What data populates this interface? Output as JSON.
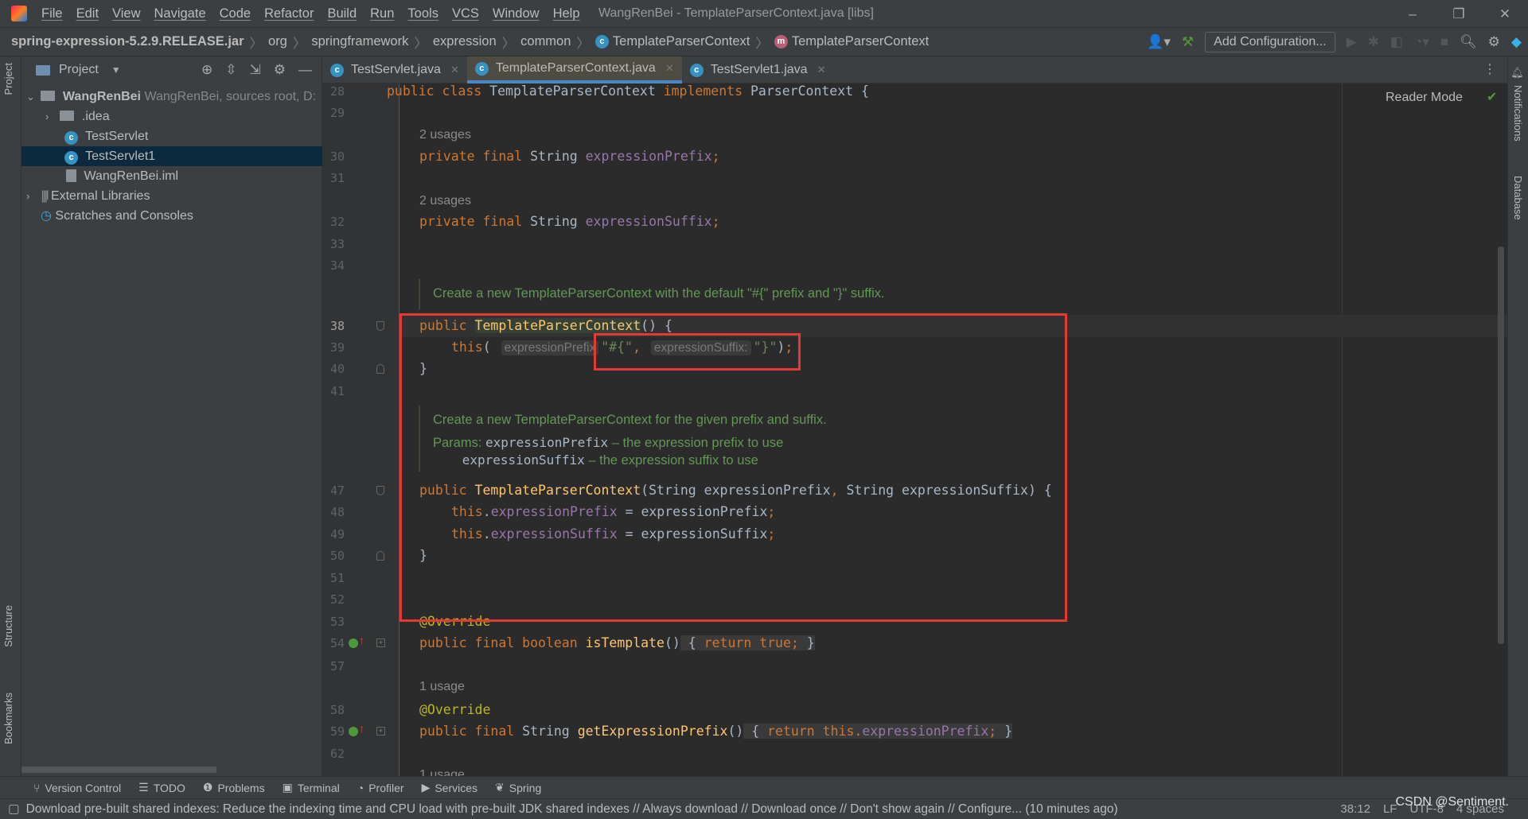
{
  "window": {
    "title": "WangRenBei - TemplateParserContext.java [libs]",
    "menu": [
      "File",
      "Edit",
      "View",
      "Navigate",
      "Code",
      "Refactor",
      "Build",
      "Run",
      "Tools",
      "VCS",
      "Window",
      "Help"
    ],
    "controls": {
      "minimize": "–",
      "restore": "❐",
      "close": "✕"
    }
  },
  "breadcrumb": {
    "jar": "spring-expression-5.2.9.RELEASE.jar",
    "packages": [
      "org",
      "springframework",
      "expression",
      "common"
    ],
    "class": "TemplateParserContext",
    "method": "TemplateParserContext"
  },
  "toolbar": {
    "add_configuration": "Add Configuration..."
  },
  "left_stripe": {
    "project": "Project",
    "structure": "Structure",
    "bookmarks": "Bookmarks"
  },
  "right_stripe": {
    "notifications": "Notifications",
    "database": "Database"
  },
  "project": {
    "title": "Project",
    "tree": [
      {
        "label": "WangRenBei",
        "hint": "WangRenBei,  sources root,  D:",
        "icon": "module-folder-icon",
        "expanded": true
      },
      {
        "label": ".idea",
        "icon": "folder-icon",
        "expanded": false
      },
      {
        "label": "TestServlet",
        "icon": "class-icon"
      },
      {
        "label": "TestServlet1",
        "icon": "class-icon",
        "selected": true
      },
      {
        "label": "WangRenBei.iml",
        "icon": "iml-file-icon"
      },
      {
        "label": "External Libraries",
        "icon": "libraries-icon",
        "expanded": false
      },
      {
        "label": "Scratches and Consoles",
        "icon": "scratches-icon"
      }
    ]
  },
  "tabs": [
    {
      "label": "TestServlet.java",
      "active": false
    },
    {
      "label": "TemplateParserContext.java",
      "active": true
    },
    {
      "label": "TestServlet1.java",
      "active": false
    }
  ],
  "editor": {
    "reader_mode": "Reader Mode",
    "current_line": "38",
    "rows": [
      {
        "kind": "code",
        "num": "28",
        "indent": 0,
        "tokens": [
          [
            "public class ",
            "k"
          ],
          [
            "TemplateParserContext ",
            "p"
          ],
          [
            "implements ",
            "k"
          ],
          [
            "ParserContext {",
            "p"
          ]
        ]
      },
      {
        "kind": "code",
        "num": "29",
        "indent": 0,
        "tokens": []
      },
      {
        "kind": "usage",
        "text": "2 usages"
      },
      {
        "kind": "code",
        "num": "30",
        "indent": 1,
        "tokens": [
          [
            "private final ",
            "k"
          ],
          [
            "String ",
            "p"
          ],
          [
            "expressionPrefix",
            "f"
          ],
          [
            ";",
            "k"
          ]
        ]
      },
      {
        "kind": "code",
        "num": "31",
        "indent": 0,
        "tokens": []
      },
      {
        "kind": "usage",
        "text": "2 usages"
      },
      {
        "kind": "code",
        "num": "32",
        "indent": 1,
        "tokens": [
          [
            "private final ",
            "k"
          ],
          [
            "String ",
            "p"
          ],
          [
            "expressionSuffix",
            "f"
          ],
          [
            ";",
            "k"
          ]
        ]
      },
      {
        "kind": "code",
        "num": "33",
        "indent": 0,
        "tokens": []
      },
      {
        "kind": "code",
        "num": "34",
        "indent": 0,
        "tokens": []
      },
      {
        "kind": "doc",
        "parts": [
          [
            "Create a new TemplateParserContext with the default \"#{\" prefix and \"}\" suffix.",
            "t"
          ]
        ]
      },
      {
        "kind": "code",
        "num": "38",
        "indent": 1,
        "fold": "open",
        "tokens": [
          [
            "public ",
            "k"
          ],
          [
            "TemplateParserContext",
            "mh"
          ],
          [
            "() {",
            "p"
          ]
        ]
      },
      {
        "kind": "code",
        "num": "39",
        "indent": 2,
        "tokens": [
          [
            "this",
            "k"
          ],
          [
            "( ",
            "p"
          ],
          [
            "expressionPrefix",
            "h"
          ],
          [
            "\"#{\"",
            "s"
          ],
          [
            ", ",
            "k"
          ],
          [
            "expressionSuffix:",
            "h"
          ],
          [
            "\"}\"",
            "s"
          ],
          [
            ")",
            "p"
          ],
          [
            ";",
            "k"
          ]
        ]
      },
      {
        "kind": "code",
        "num": "40",
        "indent": 1,
        "fold": "close",
        "tokens": [
          [
            "}",
            "p"
          ]
        ]
      },
      {
        "kind": "code",
        "num": "41",
        "indent": 0,
        "tokens": []
      },
      {
        "kind": "doc",
        "parts": [
          [
            "Create a new TemplateParserContext for the given prefix and suffix.",
            "t"
          ]
        ]
      },
      {
        "kind": "doc",
        "parts": [
          [
            "Params: ",
            "t"
          ],
          [
            "expressionPrefix",
            "mono"
          ],
          [
            " – the expression prefix to use",
            "t"
          ]
        ]
      },
      {
        "kind": "doc",
        "parts": [
          [
            "        ",
            "t"
          ],
          [
            "expressionSuffix",
            "mono"
          ],
          [
            " – the expression suffix to use",
            "t"
          ]
        ]
      },
      {
        "kind": "code",
        "num": "47",
        "indent": 1,
        "fold": "open",
        "tokens": [
          [
            "public ",
            "k"
          ],
          [
            "TemplateParserContext",
            "m"
          ],
          [
            "(String expressionPrefix",
            "p"
          ],
          [
            ", ",
            "k"
          ],
          [
            "String expressionSuffix) {",
            "p"
          ]
        ]
      },
      {
        "kind": "code",
        "num": "48",
        "indent": 2,
        "tokens": [
          [
            "this",
            "k"
          ],
          [
            ".",
            "p"
          ],
          [
            "expressionPrefix",
            "f"
          ],
          [
            " = expressionPrefix",
            "p"
          ],
          [
            ";",
            "k"
          ]
        ]
      },
      {
        "kind": "code",
        "num": "49",
        "indent": 2,
        "tokens": [
          [
            "this",
            "k"
          ],
          [
            ".",
            "p"
          ],
          [
            "expressionSuffix",
            "f"
          ],
          [
            " = expressionSuffix",
            "p"
          ],
          [
            ";",
            "k"
          ]
        ]
      },
      {
        "kind": "code",
        "num": "50",
        "indent": 1,
        "fold": "close",
        "tokens": [
          [
            "}",
            "p"
          ]
        ]
      },
      {
        "kind": "code",
        "num": "51",
        "indent": 0,
        "tokens": []
      },
      {
        "kind": "code",
        "num": "52",
        "indent": 0,
        "tokens": []
      },
      {
        "kind": "code",
        "num": "53",
        "indent": 1,
        "tokens": [
          [
            "@Override",
            "a"
          ]
        ]
      },
      {
        "kind": "code",
        "num": "54",
        "indent": 1,
        "fold": "box",
        "override": true,
        "tokens": [
          [
            "public final boolean ",
            "k"
          ],
          [
            "isTemplate",
            "m"
          ],
          [
            "()",
            "p"
          ],
          [
            " { ",
            "g"
          ],
          [
            "return true;",
            "gk"
          ],
          [
            " }",
            "g"
          ]
        ]
      },
      {
        "kind": "code",
        "num": "57",
        "indent": 0,
        "tokens": []
      },
      {
        "kind": "usage",
        "text": "1 usage"
      },
      {
        "kind": "code",
        "num": "58",
        "indent": 1,
        "tokens": [
          [
            "@Override",
            "a"
          ]
        ]
      },
      {
        "kind": "code",
        "num": "59",
        "indent": 1,
        "fold": "box",
        "override": true,
        "tokens": [
          [
            "public final ",
            "k"
          ],
          [
            "String ",
            "p"
          ],
          [
            "getExpressionPrefix",
            "m"
          ],
          [
            "()",
            "p"
          ],
          [
            " { ",
            "g"
          ],
          [
            "return this.",
            "gk"
          ],
          [
            "expressionPrefix",
            "gf"
          ],
          [
            ";",
            "gk"
          ],
          [
            " }",
            "g"
          ]
        ]
      },
      {
        "kind": "code",
        "num": "62",
        "indent": 0,
        "tokens": []
      },
      {
        "kind": "usage",
        "text": "1 usage"
      }
    ]
  },
  "tool_windows": [
    "Version Control",
    "TODO",
    "Problems",
    "Terminal",
    "Profiler",
    "Services",
    "Spring"
  ],
  "status": {
    "message": "Download pre-built shared indexes: Reduce the indexing time and CPU load with pre-built JDK shared indexes // Always download // Download once // Don't show again // Configure... (10 minutes ago)",
    "position": "38:12",
    "line_separator": "LF",
    "encoding": "UTF-8",
    "indent": "4 spaces"
  },
  "watermark": "CSDN @Sentiment.",
  "colors": {
    "keyword": "#cc7832",
    "field": "#9876aa",
    "method": "#ffc66d",
    "string": "#6a8759",
    "annotation": "#bbb529",
    "doc": "#629755",
    "highlight_box": "#e53935",
    "accent": "#4a88c7"
  }
}
